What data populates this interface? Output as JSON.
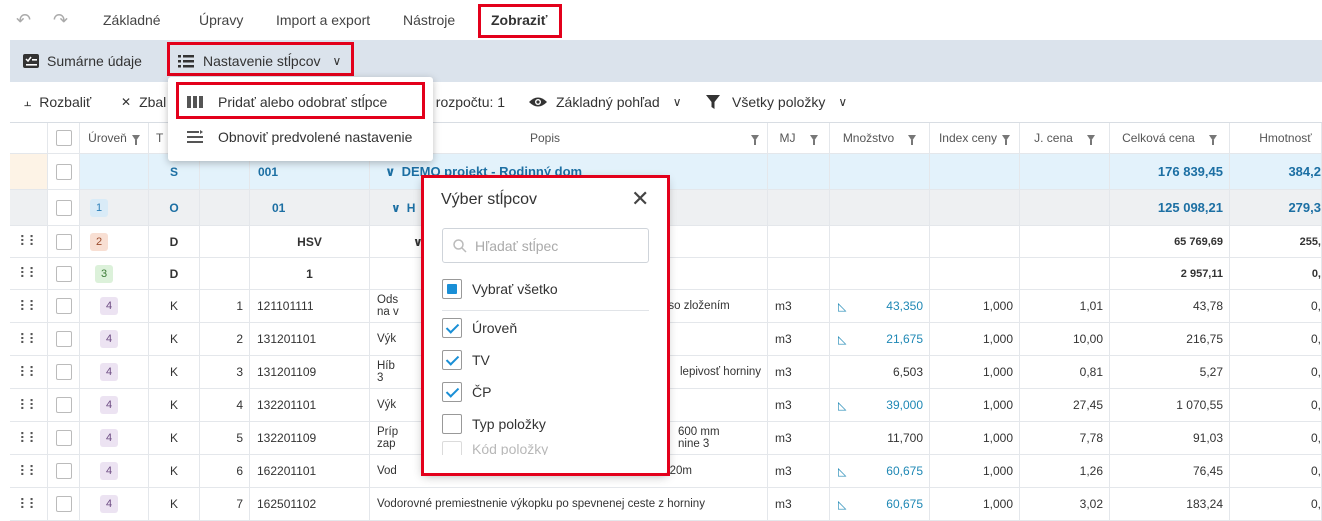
{
  "menu": {
    "tabs": [
      "Základné",
      "Úpravy",
      "Import a export",
      "Nástroje",
      "Zobraziť"
    ],
    "active_tab": "Zobraziť"
  },
  "toolbar1": {
    "summary_label": "Sumárne údaje",
    "columns_label": "Nastavenie stĺpcov"
  },
  "toolbar2": {
    "expand_label": "Rozbaliť",
    "collapse_label": "Zbal",
    "budget_label": ": rozpočtu: 1",
    "view_label": "Základný pohľad",
    "filter_label": "Všetky položky"
  },
  "dropdown": {
    "add_remove_label": "Pridať alebo odobrať stĺpce",
    "reset_label": "Obnoviť predvolené nastavenie"
  },
  "picker": {
    "title": "Výber stĺpcov",
    "search_placeholder": "Hľadať stĺpec",
    "select_all": "Vybrať všetko",
    "items": [
      {
        "label": "Úroveň",
        "checked": true
      },
      {
        "label": "TV",
        "checked": true
      },
      {
        "label": "ČP",
        "checked": true
      },
      {
        "label": "Typ položky",
        "checked": false
      },
      {
        "label": "Kód položky",
        "checked": false
      }
    ]
  },
  "grid": {
    "headers": {
      "level": "Úroveň",
      "t": "T",
      "popis": "Popis",
      "mj": "MJ",
      "mnozstvo": "Množstvo",
      "index": "Index ceny",
      "jcena": "J. cena",
      "celkova": "Celková cena",
      "hmotnost": "Hmotnosť"
    },
    "rows": [
      {
        "level": "",
        "tv": "S",
        "cp": "",
        "code": "001",
        "popis": "DEMO projekt - Rodinný dom",
        "mj": "",
        "mn": "",
        "idx": "",
        "jc": "",
        "cc": "176 839,45",
        "hm": "384,2"
      },
      {
        "level": "1",
        "tv": "O",
        "cp": "",
        "code": "01",
        "popis": "H",
        "mj": "",
        "mn": "",
        "idx": "",
        "jc": "",
        "cc": "125 098,21",
        "hm": "279,3"
      },
      {
        "level": "2",
        "tv": "D",
        "cp": "",
        "code": "HSV",
        "popis": "",
        "mj": "",
        "mn": "",
        "idx": "",
        "jc": "",
        "cc": "65 769,69",
        "hm": "255,"
      },
      {
        "level": "3",
        "tv": "D",
        "cp": "",
        "code": "1",
        "popis": "",
        "mj": "",
        "mn": "",
        "idx": "",
        "jc": "",
        "cc": "2 957,11",
        "hm": "0,"
      },
      {
        "level": "4",
        "tv": "K",
        "cp": "1",
        "code": "121101111",
        "popis": "Ods",
        "popis2": "na v",
        "popis_r": ", so zložením",
        "mj": "m3",
        "mn": "43,350",
        "idx": "1,000",
        "jc": "1,01",
        "cc": "43,78",
        "hm": "0,"
      },
      {
        "level": "4",
        "tv": "K",
        "cp": "2",
        "code": "131201101",
        "popis": "Výk",
        "popis_r": "",
        "mj": "m3",
        "mn": "21,675",
        "idx": "1,000",
        "jc": "10,00",
        "cc": "216,75",
        "hm": "0,"
      },
      {
        "level": "4",
        "tv": "K",
        "cp": "3",
        "code": "131201109",
        "popis": "Híb",
        "popis2": "3",
        "popis_r": "lepivosť horniny",
        "mj": "m3",
        "mn": "6,503",
        "idx": "1,000",
        "jc": "0,81",
        "cc": "5,27",
        "hm": "0,"
      },
      {
        "level": "4",
        "tv": "K",
        "cp": "4",
        "code": "132201101",
        "popis": "Výk",
        "popis_r": "",
        "mj": "m3",
        "mn": "39,000",
        "idx": "1,000",
        "jc": "27,45",
        "cc": "1 070,55",
        "hm": "0,"
      },
      {
        "level": "4",
        "tv": "K",
        "cp": "5",
        "code": "132201109",
        "popis": "Príp",
        "popis2": "zap",
        "popis_r": "600 mm",
        "popis_r2": "nine 3",
        "mj": "m3",
        "mn": "11,700",
        "idx": "1,000",
        "jc": "7,78",
        "cc": "91,03",
        "hm": "0,"
      },
      {
        "level": "4",
        "tv": "K",
        "cp": "6",
        "code": "162201101",
        "popis": "Vod",
        "popis_r": "o 20m",
        "mj": "m3",
        "mn": "60,675",
        "idx": "1,000",
        "jc": "1,26",
        "cc": "76,45",
        "hm": "0,"
      },
      {
        "level": "4",
        "tv": "K",
        "cp": "7",
        "code": "162501102",
        "popis": "Vodorovné premiestnenie výkopku po spevnenej ceste z horniny",
        "popis_r": "",
        "mj": "m3",
        "mn": "60,675",
        "idx": "1,000",
        "jc": "3,02",
        "cc": "183,24",
        "hm": "0,"
      }
    ]
  }
}
